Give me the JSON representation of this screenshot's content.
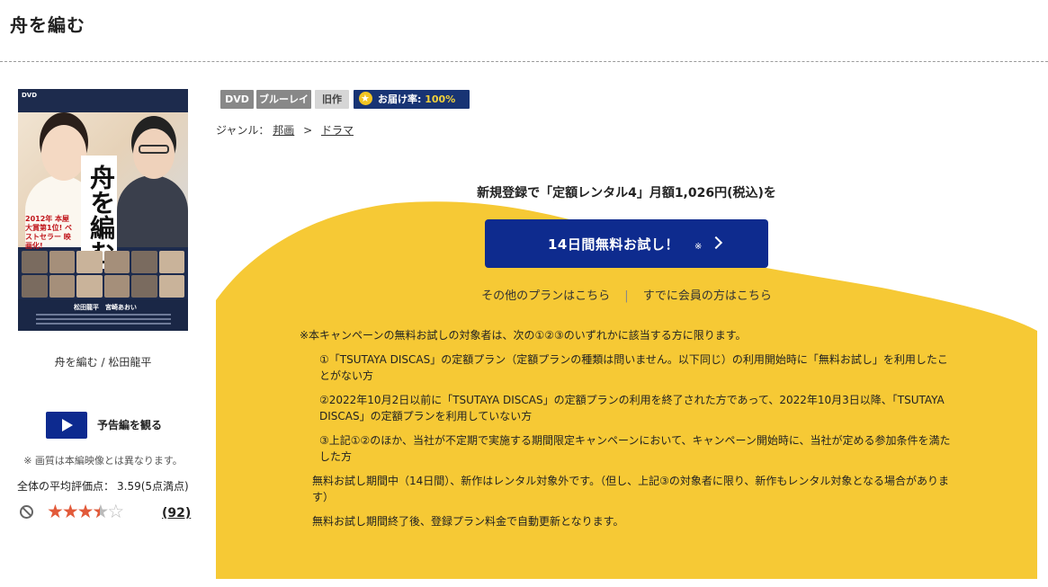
{
  "page": {
    "title": "舟を編む"
  },
  "product": {
    "caption": "舟を編む / 松田龍平",
    "cover": {
      "dvd_mark": "DVD",
      "title_vertical": "舟を編む",
      "award_text": "2012年 本屋大賞第1位! ベストセラー 映画化!",
      "cast_line": "松田龍平　宮崎あおい"
    },
    "badges": {
      "dvd": "DVD",
      "bluray": "ブルーレイ",
      "old": "旧作",
      "delivery_label": "お届け率:",
      "delivery_rate": "100%"
    },
    "genre": {
      "label": "ジャンル：",
      "items": [
        "邦画",
        "ドラマ"
      ],
      "separator": ">"
    }
  },
  "trailer": {
    "label": "予告編を観る",
    "note": "※ 画質は本編映像とは異なります。"
  },
  "rating": {
    "label": "全体の平均評価点：",
    "score": "3.59(5点満点)",
    "value": 3.59,
    "max": 5,
    "count": "(92)"
  },
  "promo": {
    "heading": "新規登録で「定額レンタル4」月額1,026円(税込)を",
    "button_label": "14日間無料お試し！",
    "button_mark": "※",
    "link_other_plans": "その他のプランはこちら",
    "link_member": "すでに会員の方はこちら",
    "link_separator": "|",
    "notes_intro": "※本キャンペーンの無料お試しの対象者は、次の①②③のいずれかに該当する方に限ります。",
    "notes_items": [
      "①「TSUTAYA DISCAS」の定額プラン（定額プランの種類は問いません。以下同じ）の利用開始時に「無料お試し」を利用したことがない方",
      "②2022年10月2日以前に「TSUTAYA DISCAS」の定額プランの利用を終了された方であって、2022年10月3日以降、「TSUTAYA DISCAS」の定額プランを利用していない方",
      "③上記①②のほか、当社が不定期で実施する期間限定キャンペーンにおいて、キャンペーン開始時に、当社が定める参加条件を満たした方"
    ],
    "notes_period": "無料お試し期間中（14日間）、新作はレンタル対象外です。（但し、上記③の対象者に限り、新作もレンタル対象となる場合があります）",
    "notes_renewal": "無料お試し期間終了後、登録プラン料金で自動更新となります。"
  },
  "colors": {
    "accent_navy": "#0e2b8e",
    "promo_yellow": "#f6c935",
    "star_orange": "#e25a3a",
    "badge_gray": "#888888",
    "badge_navy": "#183474"
  },
  "icons": {
    "play": "play-icon",
    "no_entry": "prohibited-icon",
    "medal": "medal-star-icon",
    "chevron": "chevron-right-icon"
  }
}
